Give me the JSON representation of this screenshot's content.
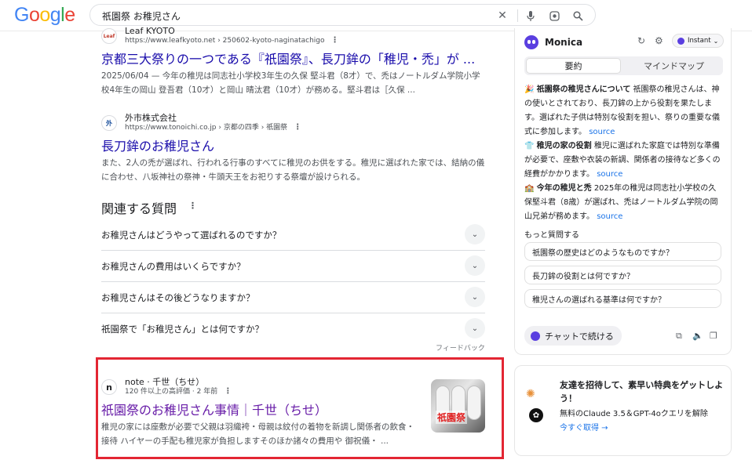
{
  "logo": {
    "letters": [
      "G",
      "o",
      "o",
      "g",
      "l",
      "e"
    ],
    "colors": [
      "#4285F4",
      "#EA4335",
      "#FBBC05",
      "#4285F4",
      "#34A853",
      "#EA4335"
    ]
  },
  "search": {
    "query": "祇園祭 お稚児さん"
  },
  "results": [
    {
      "favicon": "Leaf",
      "site": "Leaf KYOTO",
      "url": "https://www.leafkyoto.net › 250602-kyoto-naginatachigo",
      "title": "京都三大祭りの一つである『祇園祭』、長刀鉾の「稚児・禿」が ...",
      "snippet": "2025/06/04 — 今年の稚児は同志社小学校3年生の久保 堅斗君（8才）で、禿はノートルダム学院小学校4年生の岡山 登吾君（10才）と岡山 晴汰君（10才）が務める。堅斗君は［久保 ..."
    },
    {
      "favicon": "外",
      "site": "外市株式会社",
      "url": "https://www.tonoichi.co.jp › 京都の四季 › 祇園祭",
      "title": "長刀鉾のお稚児さん",
      "snippet": "また、2人の禿が選ばれ、行われる行事のすべてに稚児のお供をする。稚児に選ばれた家では、結納の儀に合わせ、八坂神社の祭神・牛頭天王をお祀りする祭壇が設けられる。"
    },
    {
      "favicon": "n",
      "site": "note · 千世（ちせ）",
      "url": "120 件以上の高評価 · 2 年前",
      "title": "祇園祭のお稚児さん事情｜千世（ちせ）",
      "snippet": "稚児の家には座敷が必要で父親は羽織袴・母親は紋付の着物を新調し関係者の飲食・接待 ハイヤーの手配も稚児家が負担しますそのほか諸々の費用や 御祝儀・ ...",
      "thumb_label": "祇園祭"
    }
  ],
  "related": {
    "title": "関連する質問",
    "questions": [
      "お稚児さんはどうやって選ばれるのですか？",
      "お稚児さんの費用はいくらですか？",
      "お稚児さんはその後どうなりますか？",
      "祇園祭で「お稚児さん」とは何ですか？"
    ],
    "feedback": "フィードバック"
  },
  "monica": {
    "name": "Monica",
    "mode": "Instant",
    "tabs": [
      "要約",
      "マインドマップ"
    ],
    "summary": [
      {
        "emoji": "🎉",
        "heading": "祇園祭の稚児さんについて",
        "text": " 祇園祭の稚児さんは、神の使いとされており、長刀鉾の上から役割を果たします。選ばれた子供は特別な役割を担い、祭りの重要な儀式に参加します。",
        "link": "source"
      },
      {
        "emoji": "👕",
        "heading": "稚児の家の役割",
        "text": " 稚児に選ばれた家庭では特別な準備が必要で、座敷や衣装の新調、関係者の接待など多くの経費がかかります。",
        "link": "source"
      },
      {
        "emoji": "🏫",
        "heading": "今年の稚児と禿",
        "text": " 2025年の稚児は同志社小学校の久保堅斗君（8歳）が選ばれ、禿はノートルダム学院の岡山兄弟が務めます。",
        "link": "source"
      }
    ],
    "more_label": "もっと質問する",
    "more_questions": [
      "祇園祭の歴史はどのようなものですか？",
      "長刀鉾の役割とは何ですか？",
      "稚児さんの選ばれる基準は何ですか？"
    ],
    "chat_button": "チャットで続ける"
  },
  "promo": {
    "title": "友達を招待して、素早い特典をゲットしよう！",
    "subtitle": "無料のClaude 3.5＆GPT-4oクエリを解除",
    "link": "今すぐ取得 →"
  }
}
